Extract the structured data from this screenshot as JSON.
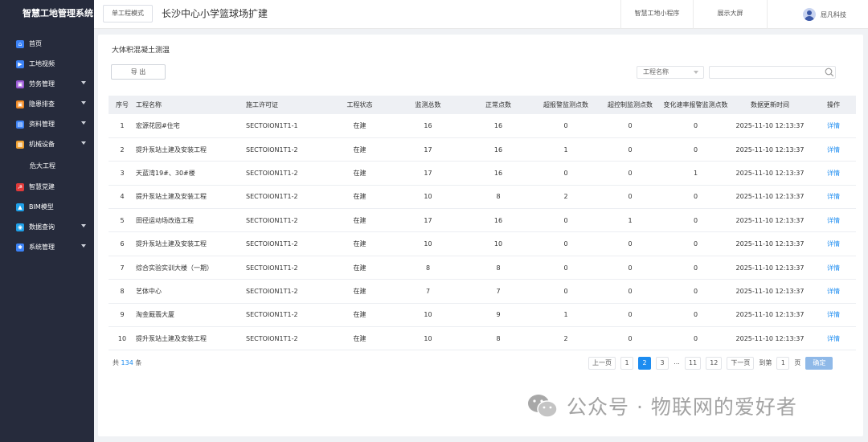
{
  "app_title": "智慧工地管理系统",
  "sidebar": {
    "items": [
      {
        "label": "首页",
        "icon": "home-icon",
        "color": "#3b82f6",
        "glyph": "⌂",
        "has_children": false
      },
      {
        "label": "工地视频",
        "icon": "video-icon",
        "color": "#3b82f6",
        "glyph": "▶",
        "has_children": false
      },
      {
        "label": "劳务管理",
        "icon": "labor-icon",
        "color": "#9b59d6",
        "glyph": "▣",
        "has_children": true
      },
      {
        "label": "隐患排查",
        "icon": "hazard-icon",
        "color": "#f08a24",
        "glyph": "▣",
        "has_children": true
      },
      {
        "label": "资料管理",
        "icon": "document-icon",
        "color": "#3b82f6",
        "glyph": "▤",
        "has_children": true
      },
      {
        "label": "机械设备",
        "icon": "equipment-icon",
        "color": "#f0a030",
        "glyph": "▦",
        "has_children": true
      },
      {
        "label": "危大工程",
        "icon": "",
        "color": "",
        "glyph": "",
        "has_children": false,
        "plain": true
      },
      {
        "label": "智慧党建",
        "icon": "party-icon",
        "color": "#e03a3a",
        "glyph": "☭",
        "has_children": false
      },
      {
        "label": "BIM模型",
        "icon": "bim-icon",
        "color": "#1fa0e8",
        "glyph": "▲",
        "has_children": false
      },
      {
        "label": "数据查询",
        "icon": "data-query-icon",
        "color": "#1fa0e8",
        "glyph": "◉",
        "has_children": true
      },
      {
        "label": "系统管理",
        "icon": "settings-icon",
        "color": "#3b82f6",
        "glyph": "✱",
        "has_children": true
      }
    ]
  },
  "topbar": {
    "mode_label": "单工程模式",
    "project_title": "长沙中心小学篮球场扩建",
    "links": [
      "智慧工地小程序",
      "展示大屏"
    ],
    "user_name": "屈凡科技"
  },
  "panel": {
    "title": "大体积混凝土测温",
    "export_label": "导 出",
    "project_select_label": "工程名称",
    "search_value": ""
  },
  "table": {
    "headers": [
      "序号",
      "工程名称",
      "施工许可证",
      "工程状态",
      "监测总数",
      "正常点数",
      "超报警监测点数",
      "超控制监测点数",
      "变化速率报警监测点数",
      "数据更新时间",
      "操作"
    ],
    "rows": [
      [
        "1",
        "宏源花园#住宅",
        "SECTOION1T1-1",
        "在建",
        "16",
        "16",
        "0",
        "0",
        "0",
        "2025-11-10  12:13:37",
        "详情"
      ],
      [
        "2",
        "提升泵站土建及安装工程",
        "SECTOION1T1-2",
        "在建",
        "17",
        "16",
        "1",
        "0",
        "0",
        "2025-11-10  12:13:37",
        "详情"
      ],
      [
        "3",
        "天蓝湾19#、30#楼",
        "SECTOION1T1-2",
        "在建",
        "17",
        "16",
        "0",
        "0",
        "1",
        "2025-11-10  12:13:37",
        "详情"
      ],
      [
        "4",
        "提升泵站土建及安装工程",
        "SECTOION1T1-2",
        "在建",
        "10",
        "8",
        "2",
        "0",
        "0",
        "2025-11-10  12:13:37",
        "详情"
      ],
      [
        "5",
        "田径运动场改造工程",
        "SECTOION1T1-2",
        "在建",
        "17",
        "16",
        "0",
        "1",
        "0",
        "2025-11-10  12:13:37",
        "详情"
      ],
      [
        "6",
        "提升泵站土建及安装工程",
        "SECTOION1T1-2",
        "在建",
        "10",
        "10",
        "0",
        "0",
        "0",
        "2025-11-10  12:13:37",
        "详情"
      ],
      [
        "7",
        "综合实验实训大楼（一期）",
        "SECTOION1T1-2",
        "在建",
        "8",
        "8",
        "0",
        "0",
        "0",
        "2025-11-10  12:13:37",
        "详情"
      ],
      [
        "8",
        "艺体中心",
        "SECTOION1T1-2",
        "在建",
        "7",
        "7",
        "0",
        "0",
        "0",
        "2025-11-10  12:13:37",
        "详情"
      ],
      [
        "9",
        "淘金厩翡大厦",
        "SECTOION1T1-2",
        "在建",
        "10",
        "9",
        "1",
        "0",
        "0",
        "2025-11-10  12:13:37",
        "详情"
      ],
      [
        "10",
        "提升泵站土建及安装工程",
        "SECTOION1T1-2",
        "在建",
        "10",
        "8",
        "2",
        "0",
        "0",
        "2025-11-10  12:13:37",
        "详情"
      ]
    ]
  },
  "footer": {
    "total_prefix": "共",
    "total_count": "134",
    "total_suffix": "条",
    "prev_label": "上一页",
    "pages": [
      "1",
      "2",
      "3",
      "...",
      "11",
      "12"
    ],
    "active_page": "2",
    "next_label": "下一页",
    "goto_label": "到第",
    "goto_value": "1",
    "page_unit": "页",
    "confirm_label": "确定"
  },
  "watermark": {
    "text": "公众号 · 物联网的爱好者"
  },
  "colors": {
    "sidebar_bg": "#262b3c",
    "accent": "#1d8cf0",
    "confirm_bg": "#8fb9e8"
  }
}
